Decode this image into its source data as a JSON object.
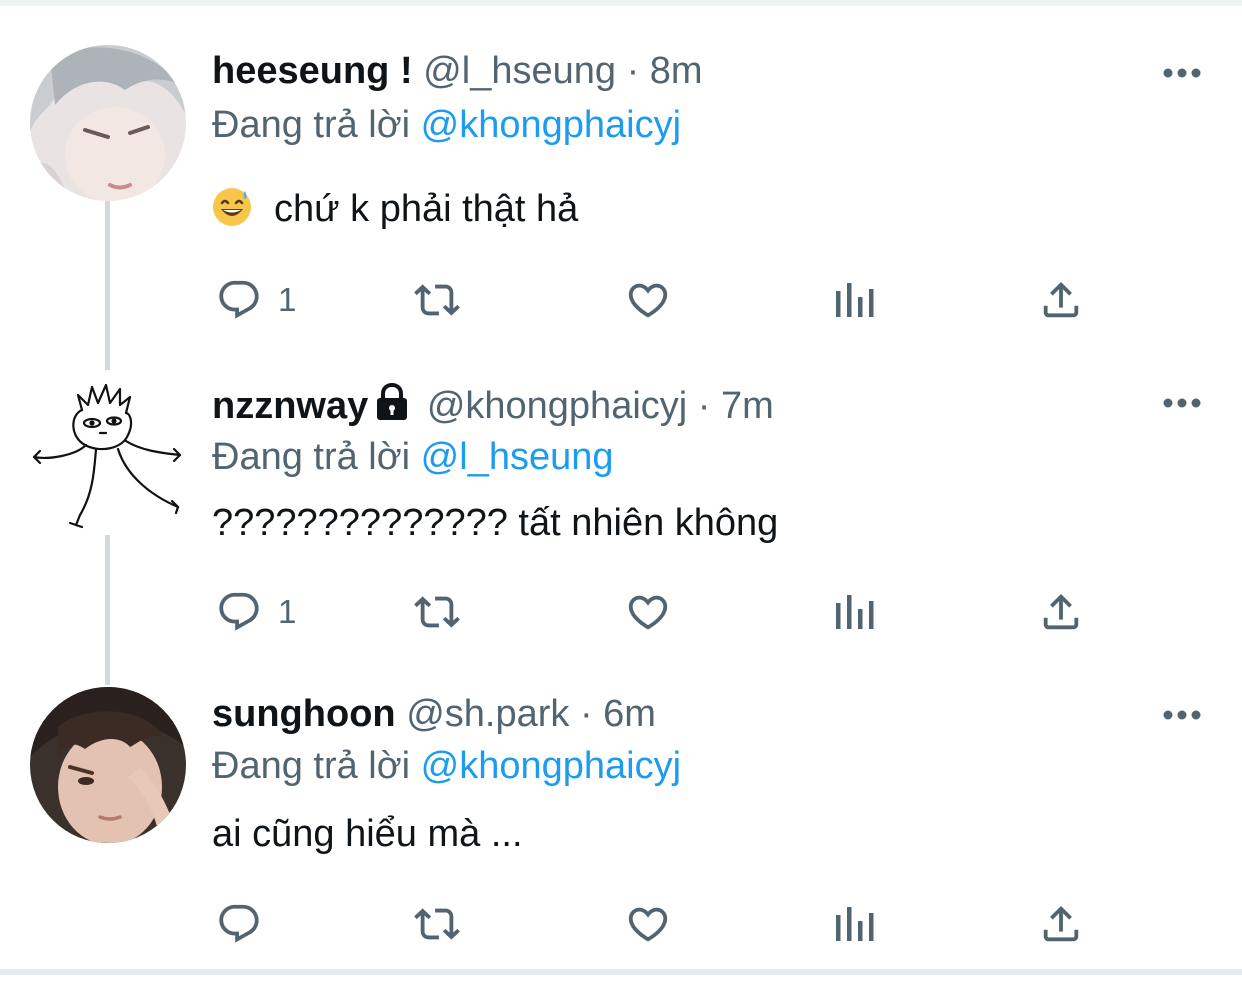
{
  "tweets": [
    {
      "name": "heeseung !",
      "handle": "@l_hseung",
      "time": "8m",
      "reply_prefix": "Đang trả lời",
      "reply_to": "@khongphaicyj",
      "text": "chứ k phải thật hả",
      "emoji": "sweat-smile-emoji",
      "reply_count": "1",
      "locked": false
    },
    {
      "name": "nzznway",
      "handle": "@khongphaicyj",
      "time": "7m",
      "reply_prefix": "Đang trả lời",
      "reply_to": "@l_hseung",
      "text": "?????????????? tất nhiên không",
      "reply_count": "1",
      "locked": true
    },
    {
      "name": "sunghoon",
      "handle": "@sh.park",
      "time": "6m",
      "reply_prefix": "Đang trả lời",
      "reply_to": "@khongphaicyj",
      "text": "ai cũng hiểu mà ...",
      "reply_count": "",
      "locked": false
    }
  ],
  "separator": "·",
  "icons": {
    "reply": "reply-icon",
    "retweet": "retweet-icon",
    "like": "like-icon",
    "views": "views-icon",
    "share": "share-icon",
    "more": "more-icon",
    "lock": "lock-icon"
  },
  "colors": {
    "text": "#0f1419",
    "muted": "#536471",
    "link": "#1d9bf0",
    "thread_line": "#cfd9de"
  }
}
